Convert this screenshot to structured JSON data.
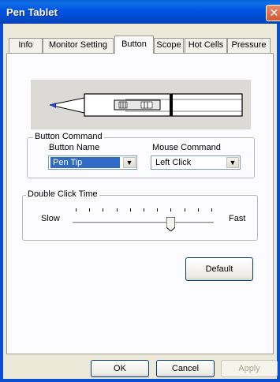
{
  "window": {
    "title": "Pen Tablet",
    "close_glyph": "✕"
  },
  "tabs": [
    {
      "label": "Info"
    },
    {
      "label": "Monitor Setting"
    },
    {
      "label": "Button"
    },
    {
      "label": "Scope"
    },
    {
      "label": "Hot Cells"
    },
    {
      "label": "Pressure"
    }
  ],
  "active_tab": "Button",
  "button_command": {
    "group_label": "Button Command",
    "button_name_label": "Button Name",
    "mouse_command_label": "Mouse Command",
    "button_name_value": "Pen Tip",
    "mouse_command_value": "Left Click"
  },
  "double_click": {
    "group_label": "Double Click Time",
    "slow_label": "Slow",
    "fast_label": "Fast",
    "tick_count": 11,
    "slider_level": 0.7
  },
  "default_button": "Default",
  "footer": {
    "ok": "OK",
    "cancel": "Cancel",
    "apply": "Apply"
  },
  "colors": {
    "title_bar": "#0054e3",
    "selection": "#316ac5",
    "pen_accent": "#1f3fc8"
  }
}
